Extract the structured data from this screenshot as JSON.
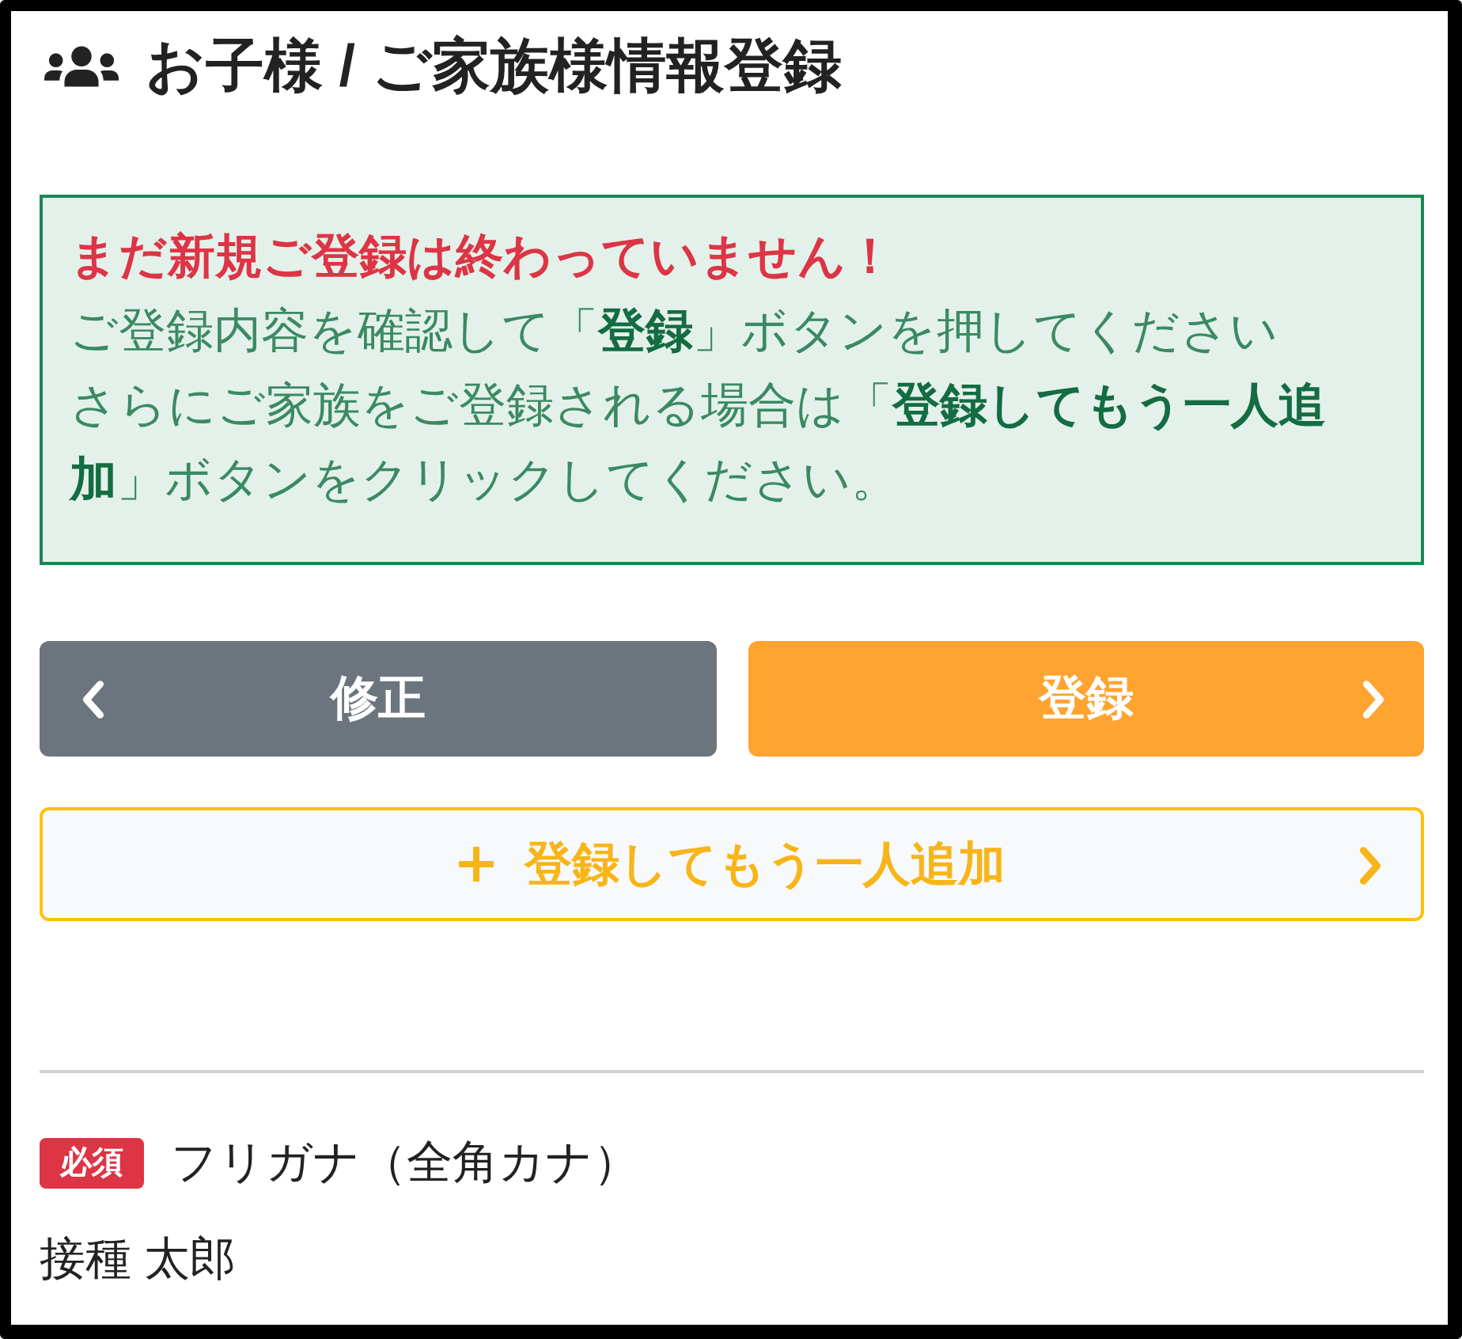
{
  "header": {
    "title": "お子様 / ご家族様情報登録"
  },
  "notice": {
    "heading": "まだ新規ご登録は終わっていません！",
    "lines": [
      "ご登録内容を確認して「**登録**」ボタンを押してください",
      "さらにご家族をご登録される場合は「**登録してもう一人追加**」ボタンをクリックしてください。"
    ]
  },
  "nav_buttons": [
    {
      "kind": "back",
      "label": "修正"
    },
    {
      "kind": "submit",
      "label": "登録"
    }
  ],
  "add_button": {
    "label": "登録してもう一人追加"
  },
  "field": {
    "required_badge": "必須",
    "label": "フリガナ（全角カナ）",
    "value": "接種 太郎"
  }
}
